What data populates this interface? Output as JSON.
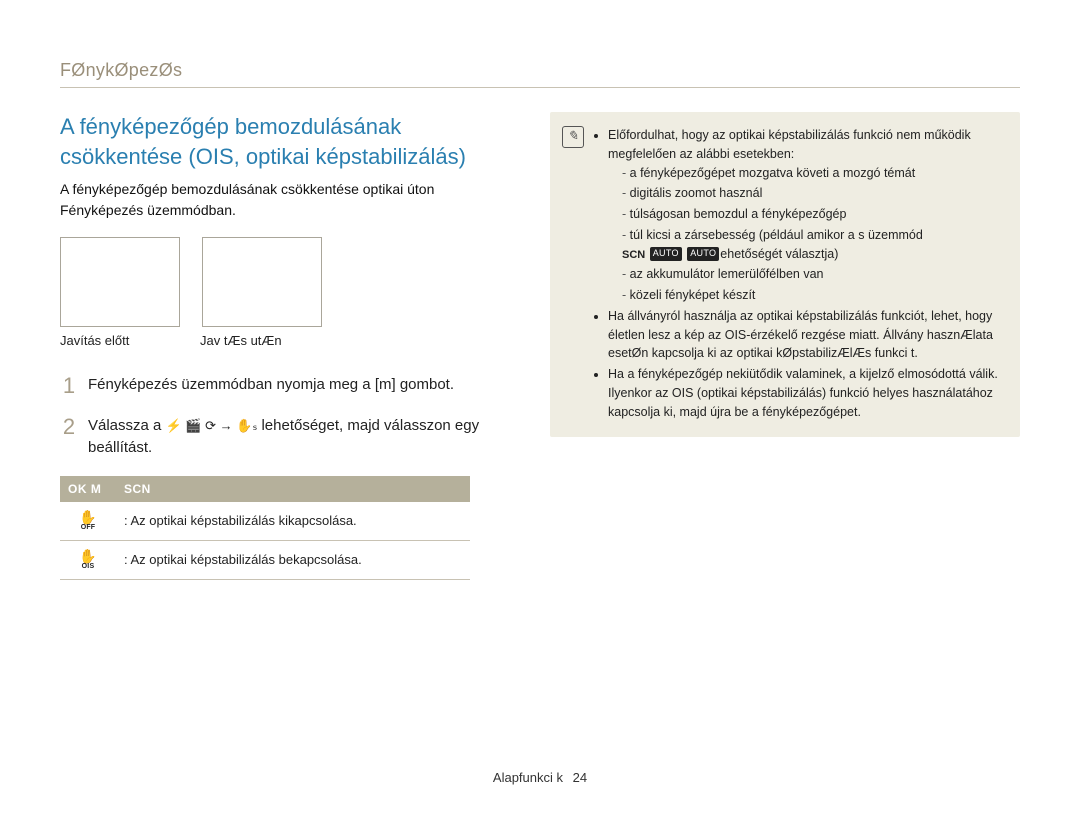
{
  "breadcrumb": "FØnykØpezØs",
  "heading": "A fényképezőgép bemozdulásának csökkentése (OIS, optikai képstabilizálás)",
  "intro": "A fényképezőgép bemozdulásának csökkentése optikai úton Fényképezés üzemmódban.",
  "captions": {
    "before": "Javítás előtt",
    "after": "Jav tÆs utÆn"
  },
  "steps": {
    "s1_pre": "Fényképezés üzemmódban nyomja meg a [m",
    "s1_post": "] gombot.",
    "s2_pre": "Válassza a ",
    "s2_mid": " lehetőséget, majd válasszon egy beállítást.",
    "icon_seq": "⚡   🎬 ⟳ →   ✋ₛ"
  },
  "table": {
    "head1": "OK M",
    "head2": "SCN",
    "r1_icon_sub": "OFF",
    "r1_text": ": Az optikai képstabilizálás kikapcsolása.",
    "r2_icon_sub": "OIS",
    "r2_text": ": Az optikai képstabilizálás bekapcsolása."
  },
  "note": {
    "b1": "Előfordulhat, hogy az optikai képstabilizálás funkció nem működik megfelelően az alábbi esetekben:",
    "s1": "a fényképezőgépet mozgatva követi a mozgó témát",
    "s2": "digitális zoomot használ",
    "s3": "túlságosan bemozdul a fényképezőgép",
    "s4_pre": "túl kicsi a zársebesség (például amikor a s",
    "s4_post": " üzemmód",
    "s4b_pre": " ",
    "s4b_post": "ehetőségét választja)",
    "s5": "az akkumulátor lemerülőfélben van",
    "s6": "közeli fényképet készít",
    "b2": "Ha állványról használja az optikai képstabilizálás funkciót, lehet, hogy életlen lesz a kép az OIS-érzékelő rezgése miatt. Állvány hasznÆlata esetØn kapcsolja ki az optikai kØpstabilizÆlÆs funkci t.",
    "b3": "Ha a fényképezőgép nekiütődik valaminek, a kijelző elmosódottá válik. Ilyenkor az OIS (optikai képstabilizálás) funkció helyes használatához kapcsolja ki, majd újra be a fényképezőgépet.",
    "scn": "SCN",
    "tag1": "AUTO",
    "tag2": "AUTO"
  },
  "footer": {
    "section": "Alapfunkci k",
    "page": "24"
  }
}
